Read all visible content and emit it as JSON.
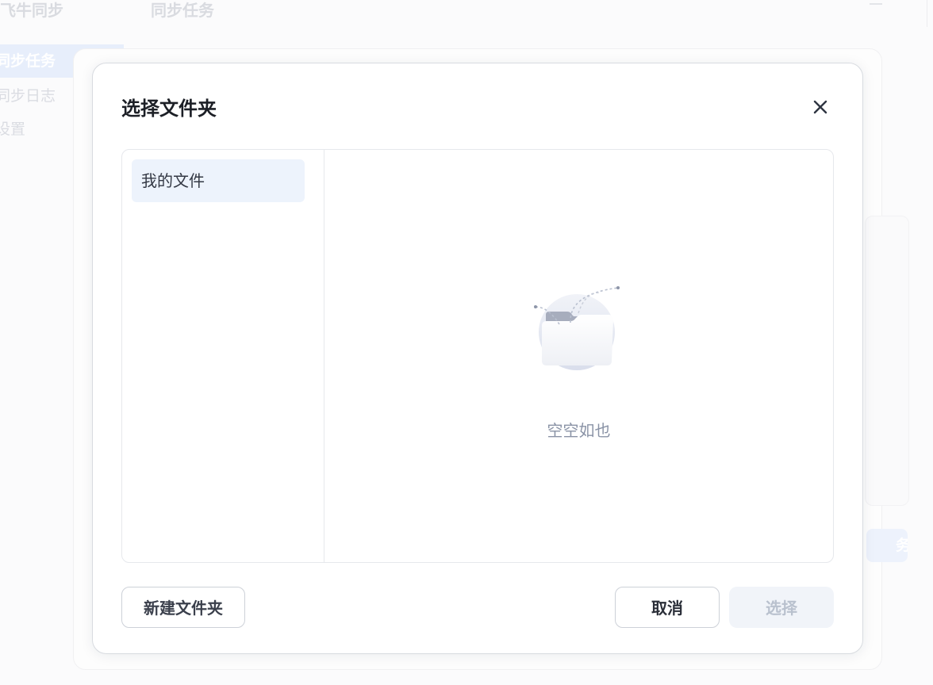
{
  "app": {
    "title": "飞牛同步",
    "page_title": "同步任务",
    "nav": [
      {
        "label": "同步任务",
        "active": true
      },
      {
        "label": "同步日志",
        "active": false
      },
      {
        "label": "设置",
        "active": false
      }
    ],
    "bg_button_label": "务"
  },
  "dialog": {
    "title": "选择文件夹",
    "close_icon": "close-icon",
    "tree": {
      "items": [
        {
          "label": "我的文件",
          "selected": true
        }
      ]
    },
    "content": {
      "empty_icon": "empty-folder-illustration",
      "empty_text": "空空如也"
    },
    "buttons": {
      "new_folder": "新建文件夹",
      "cancel": "取消",
      "select": "选择",
      "select_disabled": true
    }
  },
  "colors": {
    "selected_bg": "#edf3fc",
    "muted_text": "#8a93a6",
    "disabled_btn_bg": "#f1f4f9",
    "disabled_btn_text": "#b9c1ce"
  }
}
